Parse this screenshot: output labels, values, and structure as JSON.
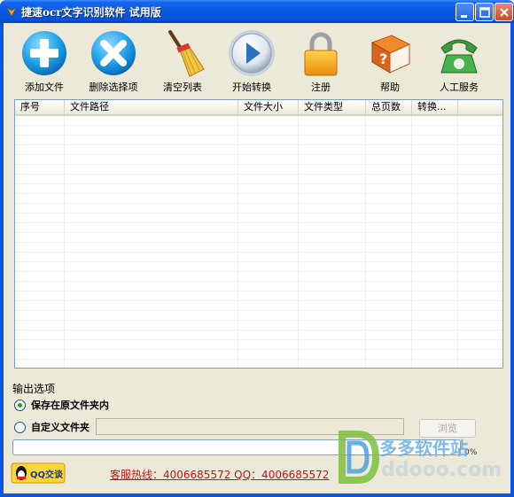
{
  "window": {
    "title": "捷速ocr文字识别软件  试用版"
  },
  "toolbar": {
    "items": [
      {
        "label": "添加文件",
        "icon": "add-circle-icon"
      },
      {
        "label": "删除选择项",
        "icon": "delete-x-icon"
      },
      {
        "label": "清空列表",
        "icon": "broom-icon"
      },
      {
        "label": "开始转换",
        "icon": "play-icon"
      },
      {
        "label": "注册",
        "icon": "lock-icon"
      },
      {
        "label": "帮助",
        "icon": "help-book-icon"
      },
      {
        "label": "人工服务",
        "icon": "phone-icon"
      }
    ]
  },
  "file_list": {
    "columns": [
      "序号",
      "文件路径",
      "文件大小",
      "文件类型",
      "总页数",
      "转换..."
    ],
    "rows": []
  },
  "output": {
    "section_title": "输出选项",
    "option_original": "保存在原文件夹内",
    "option_custom": "自定义文件夹",
    "selected": "original",
    "folder_value": "",
    "browse_label": "浏览"
  },
  "progress": {
    "percent": 0,
    "label": "0%"
  },
  "footer": {
    "qq_label": "QQ交谈",
    "hotline": "客服热线：4006685572 QQ：4006685572"
  },
  "watermark": {
    "cn": "多多软件站",
    "en": "ddooo.com"
  },
  "colors": {
    "title_bar": "#0a58e3",
    "face": "#ece9d8",
    "hotline": "#c0141a",
    "progress": "#2bc52b"
  }
}
